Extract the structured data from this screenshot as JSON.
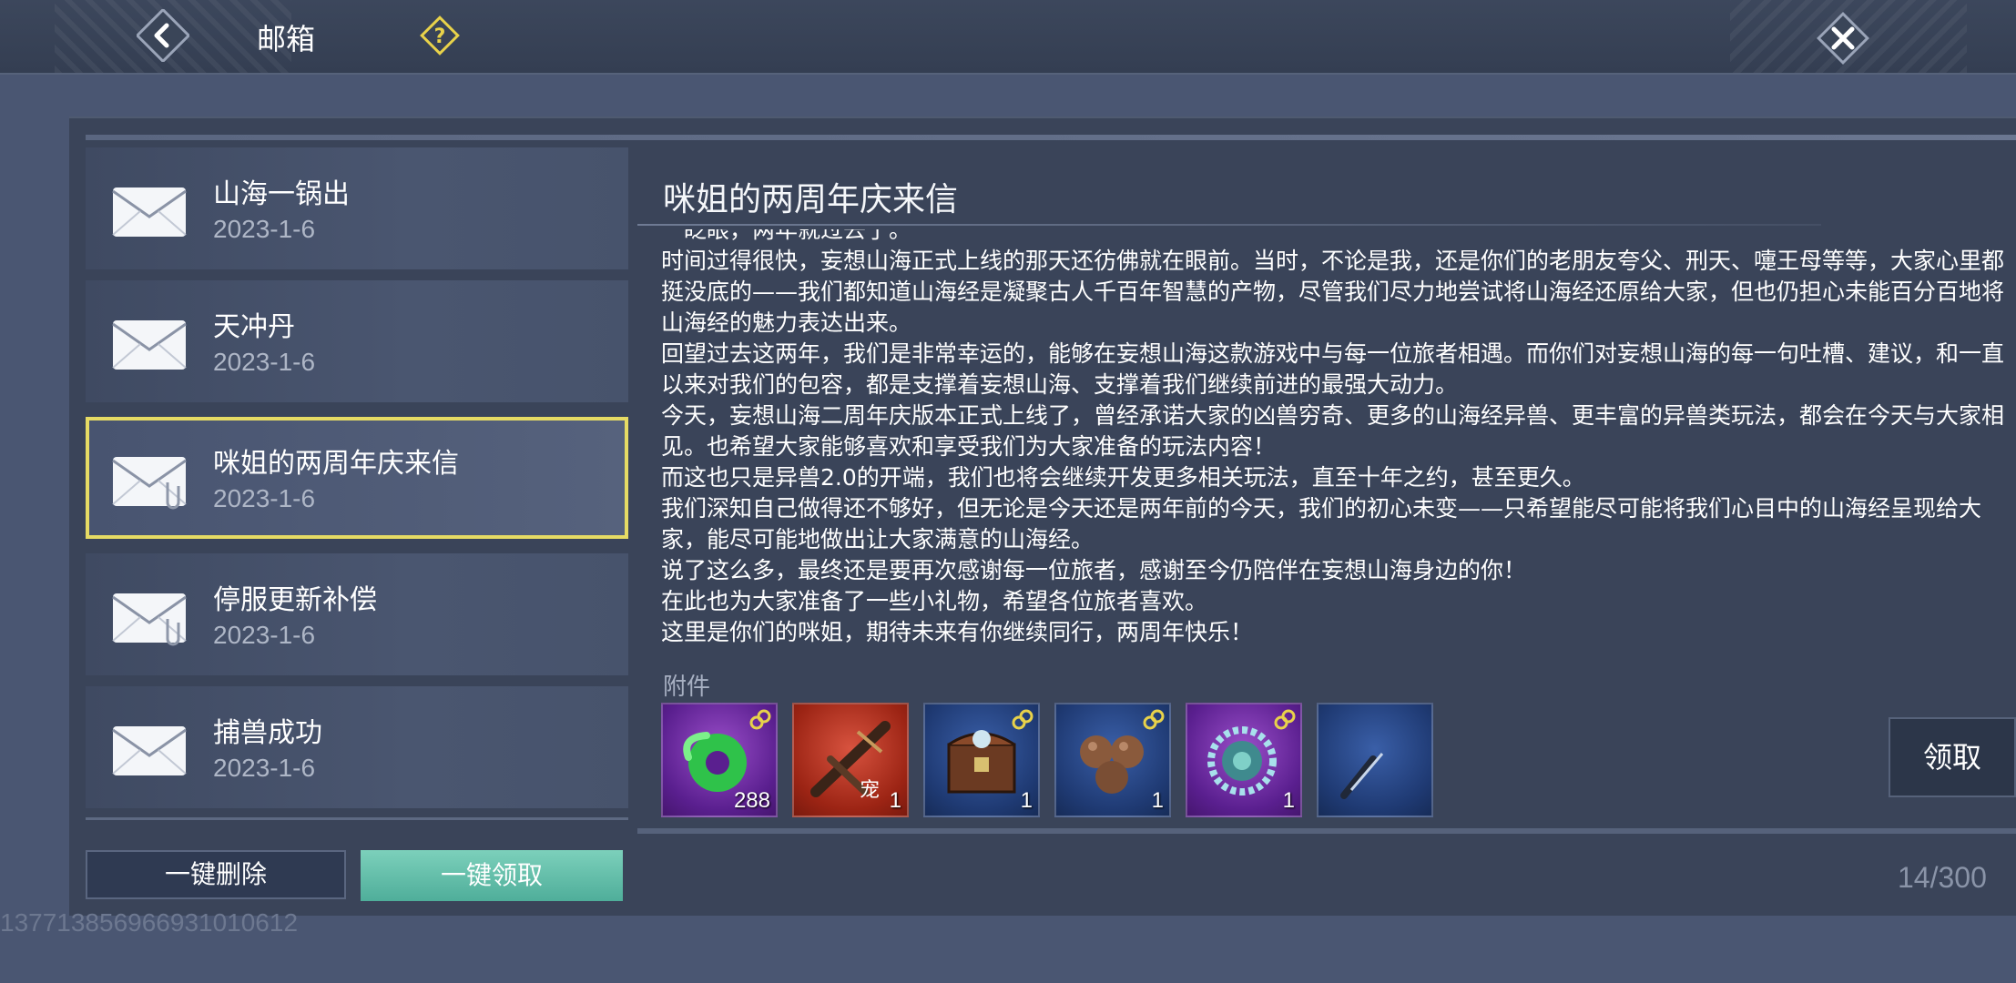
{
  "header": {
    "title": "邮箱",
    "back_icon": "back-arrow-icon",
    "help_icon": "help-question-icon",
    "close_icon": "close-x-icon"
  },
  "mail_list": [
    {
      "subject": "山海一锅出",
      "date": "2023-1-6",
      "has_attachment": false,
      "selected": false
    },
    {
      "subject": "天冲丹",
      "date": "2023-1-6",
      "has_attachment": false,
      "selected": false
    },
    {
      "subject": "咪姐的两周年庆来信",
      "date": "2023-1-6",
      "has_attachment": true,
      "selected": true
    },
    {
      "subject": "停服更新补偿",
      "date": "2023-1-6",
      "has_attachment": true,
      "selected": false
    },
    {
      "subject": "捕兽成功",
      "date": "2023-1-6",
      "has_attachment": false,
      "selected": false
    }
  ],
  "buttons": {
    "delete_all": "一键删除",
    "claim_all": "一键领取",
    "receive": "领取"
  },
  "detail": {
    "title": "咪姐的两周年庆来信",
    "body": "一眨眼，两年就过去了。\n时间过得很快，妄想山海正式上线的那天还彷佛就在眼前。当时，不论是我，还是你们的老朋友夸父、刑天、嚏王母等等，大家心里都挺没底的——我们都知道山海经是凝聚古人千百年智慧的产物，尽管我们尽力地尝试将山海经还原给大家，但也仍担心未能百分百地将山海经的魅力表达出来。\n回望过去这两年，我们是非常幸运的，能够在妄想山海这款游戏中与每一位旅者相遇。而你们对妄想山海的每一句吐槽、建议，和一直以来对我们的包容，都是支撑着妄想山海、支撑着我们继续前进的最强大动力。\n今天，妄想山海二周年庆版本正式上线了，曾经承诺大家的凶兽穷奇、更多的山海经异兽、更丰富的异兽类玩法，都会在今天与大家相见。也希望大家能够喜欢和享受我们为大家准备的玩法内容！\n而这也只是异兽2.0的开端，我们也将会继续开发更多相关玩法，直至十年之约，甚至更久。\n我们深知自己做得还不够好，但无论是今天还是两年前的今天，我们的初心未变——只希望能尽可能将我们心目中的山海经呈现给大家，能尽可能地做出让大家满意的山海经。\n说了这么多，最终还是要再次感谢每一位旅者，感谢至今仍陪伴在妄想山海身边的你！\n在此也为大家准备了一些小礼物，希望各位旅者喜欢。\n这里是你们的咪姐，期待未来有你继续同行，两周年快乐！",
    "attachment_label": "附件",
    "attachments": [
      {
        "icon": "green-jade-ring-icon",
        "quality": "purple",
        "count": "288",
        "tag": "",
        "bound": true
      },
      {
        "icon": "crossbow-weapon-icon",
        "quality": "red",
        "count": "1",
        "tag": "宠",
        "bound": false
      },
      {
        "icon": "treasure-chest-icon",
        "quality": "blue",
        "count": "1",
        "tag": "",
        "bound": true
      },
      {
        "icon": "brown-pills-icon",
        "quality": "blue",
        "count": "1",
        "tag": "",
        "bound": true
      },
      {
        "icon": "jade-pendant-icon",
        "quality": "purple",
        "count": "1",
        "tag": "",
        "bound": true
      },
      {
        "icon": "blade-icon",
        "quality": "blue",
        "count": "",
        "tag": "",
        "bound": false
      }
    ]
  },
  "footer": {
    "counter": "14/300",
    "player_id": "137713856966931010612"
  },
  "colors": {
    "background": "#4a5672",
    "panel": "#3a4459",
    "selected_border": "#e6db64",
    "claim_button": "#5fbfa8"
  }
}
